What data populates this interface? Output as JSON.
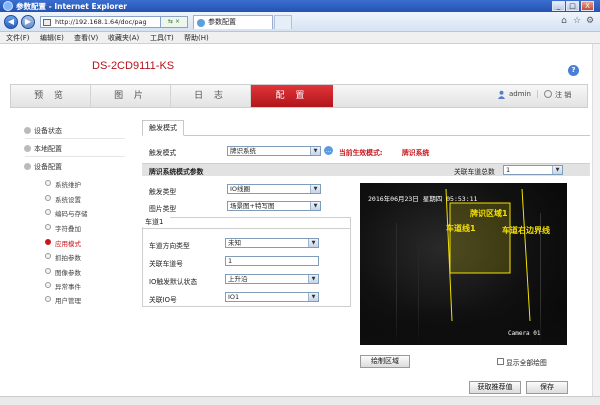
{
  "window": {
    "title": "参数配置 - Internet Explorer",
    "min": "_",
    "max": "□",
    "close": "X"
  },
  "addressbar": {
    "back": "◀",
    "forward": "▶",
    "url": "http://192.168.1.64/doc/pag",
    "url_controls": "▾ ✕",
    "refresh_box": "⇆ ×",
    "tab_title": "参数配置",
    "right_icons": [
      "⌂",
      "☆",
      "⚙"
    ]
  },
  "menubar": [
    "文件(F)",
    "编辑(E)",
    "查看(V)",
    "收藏夹(A)",
    "工具(T)",
    "帮助(H)"
  ],
  "device": {
    "name": "DS-2CD9111-KS"
  },
  "nav": {
    "tabs": [
      "预 览",
      "图 片",
      "日 志",
      "配 置"
    ],
    "active": 3
  },
  "user": {
    "name": "admin",
    "logout": "注 销"
  },
  "sidebar": {
    "groups": [
      "设备状态",
      "本地配置",
      "设备配置"
    ],
    "subitems": [
      "系统维护",
      "系统设置",
      "编码与存储",
      "字符叠加",
      "应用模式",
      "抓拍参数",
      "图像参数",
      "异常事件",
      "用户管理"
    ],
    "active_sub": 4
  },
  "trigger": {
    "tab": "触发模式",
    "mode_label": "触发模式",
    "mode_value": "牌识系统",
    "current_label": "当前生效模式:",
    "current_value": "牌识系统",
    "section_title": "牌识系统模式参数",
    "lane_count_label": "关联车道总数",
    "lane_count_value": "1",
    "trigger_type_label": "触发类型",
    "trigger_type_value": "IO线圈",
    "pic_type_label": "图片类型",
    "pic_type_value": "场景图+特写图"
  },
  "lane": {
    "tab": "车道1",
    "dir_label": "车道方向类型",
    "dir_value": "未知",
    "num_label": "关联车道号",
    "num_value": "1",
    "io_state_label": "IO触发默认状态",
    "io_state_value": "上升沿",
    "io_num_label": "关联IO号",
    "io_num_value": "IO1"
  },
  "video": {
    "osd": "2016年06月23日 星期四 05:53:11",
    "camera": "Camera 01",
    "zone_label": "牌识区域1",
    "lane1_label": "车道线1",
    "lane_right_label": "车道右边界线"
  },
  "buttons": {
    "draw_area": "绘制区域",
    "show_all": "显示全部绘图",
    "get_recommended": "获取推荐值",
    "save": "保存"
  },
  "colors": {
    "accent": "#c8161d",
    "overlay": "#f3e100"
  }
}
